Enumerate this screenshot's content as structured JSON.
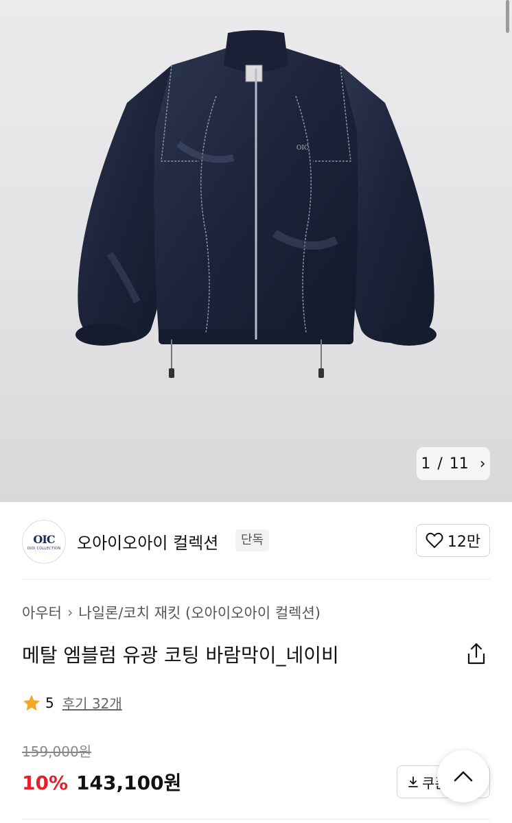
{
  "gallery": {
    "current": "1",
    "separator": "/",
    "total": "11"
  },
  "brand": {
    "logo_mark": "OIC",
    "logo_sub": "OIOI COLLECTION",
    "name": "오아이오아이 컬렉션",
    "badge": "단독",
    "likes": "12만"
  },
  "breadcrumb": {
    "category": "아우터",
    "subcategory": "나일론/코치 재킷 (오아이오아이 컬렉션)"
  },
  "product": {
    "title": "메탈 엠블럼 유광 코팅 바람막이_네이비"
  },
  "rating": {
    "score": "5",
    "reviews": "후기 32개"
  },
  "price": {
    "original": "159,000원",
    "discount": "10%",
    "final": "143,100원"
  },
  "coupon": {
    "label": "쿠폰"
  },
  "colors": {
    "accent_red": "#e4202b",
    "star": "#f5a623",
    "brand_navy": "#1d2b5a"
  }
}
